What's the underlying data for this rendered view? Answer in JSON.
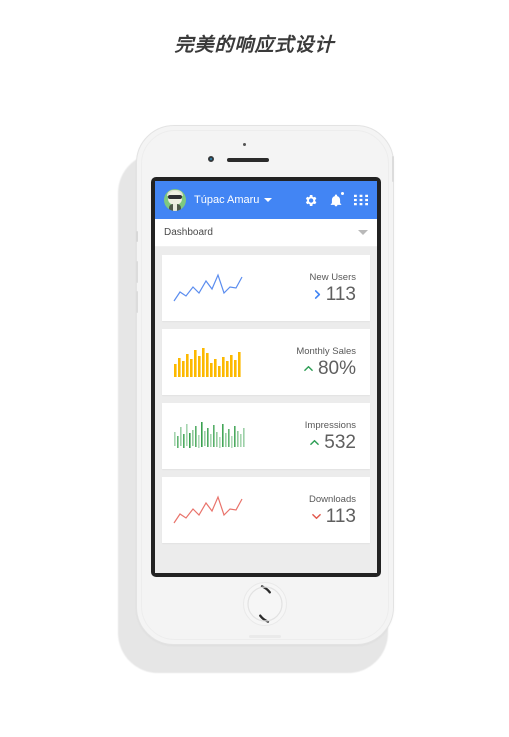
{
  "headline": "完美的响应式设计",
  "app": {
    "bar": {
      "avatar_name": "user-avatar",
      "user_name": "Túpac Amaru",
      "dropdown_icon": "chevron-down-icon",
      "icons": [
        {
          "name": "gear-icon",
          "label": "Settings"
        },
        {
          "name": "bell-icon",
          "label": "Notifications"
        },
        {
          "name": "apps-grid-icon",
          "label": "Apps"
        }
      ],
      "background_color": "#4285f4"
    },
    "select": {
      "value": "Dashboard",
      "caret_icon": "chevron-down-icon"
    },
    "cards": [
      {
        "title": "New Users",
        "value": "113",
        "trend_icon": "chevron-right-icon",
        "trend_color": "#4285f4",
        "chart": {
          "type": "line",
          "color": "#5b8def",
          "values": [
            8,
            22,
            15,
            30,
            20,
            42,
            28,
            56,
            18,
            34,
            30,
            33,
            44,
            62
          ]
        }
      },
      {
        "title": "Monthly Sales",
        "value": "80%",
        "trend_icon": "chevron-up-icon",
        "trend_color": "#2e9e55",
        "chart": {
          "type": "bar",
          "color": "#fcb900",
          "values": [
            30,
            55,
            42,
            68,
            50,
            80,
            62,
            90,
            70,
            40,
            52,
            36,
            58,
            48,
            66,
            54,
            74
          ]
        }
      },
      {
        "title": "Impressions",
        "value": "532",
        "trend_icon": "chevron-up-icon",
        "trend_color": "#2e9e55",
        "chart": {
          "type": "bar",
          "color": "#3aa14f",
          "values": [
            35,
            20,
            55,
            28,
            70,
            30,
            45,
            60,
            25,
            80,
            38,
            58,
            30,
            66,
            42,
            22,
            68,
            36,
            50,
            26,
            62,
            44,
            30,
            56
          ]
        }
      },
      {
        "title": "Downloads",
        "value": "113",
        "trend_icon": "chevron-down-icon",
        "trend_color": "#e2584d",
        "chart": {
          "type": "line",
          "color": "#e9736b",
          "values": [
            8,
            22,
            15,
            30,
            20,
            42,
            28,
            56,
            18,
            34,
            30,
            33,
            44,
            62
          ]
        }
      }
    ]
  },
  "device": {
    "sensor_icon": "proximity-sensor",
    "camera_icon": "front-camera-icon",
    "earpiece_icon": "earpiece-speaker",
    "home_button_icon": "home-button-icon",
    "body_color": "#f4f4f4"
  }
}
